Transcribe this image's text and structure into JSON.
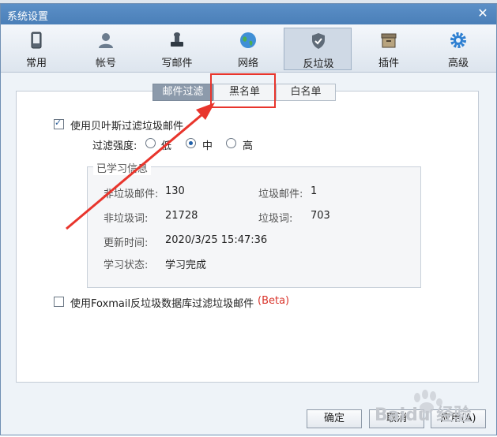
{
  "window": {
    "title": "系统设置",
    "close_glyph": "✕"
  },
  "toolbar": {
    "items": [
      {
        "label": "常用",
        "icon": "phone-icon"
      },
      {
        "label": "帐号",
        "icon": "user-icon"
      },
      {
        "label": "写邮件",
        "icon": "ink-stamp-icon"
      },
      {
        "label": "网络",
        "icon": "globe-icon"
      },
      {
        "label": "反垃圾",
        "icon": "shield-icon",
        "active": true
      },
      {
        "label": "插件",
        "icon": "box-icon"
      },
      {
        "label": "高级",
        "icon": "gear-icon"
      }
    ]
  },
  "tabs": {
    "items": [
      {
        "label": "邮件过滤",
        "active": true
      },
      {
        "label": "黑名单",
        "active": false
      },
      {
        "label": "白名单",
        "active": false
      }
    ]
  },
  "bayes": {
    "label": "使用贝叶斯过滤垃圾邮件",
    "checked": true,
    "strength_label": "过滤强度:",
    "options": [
      {
        "label": "低",
        "checked": false
      },
      {
        "label": "中",
        "checked": true
      },
      {
        "label": "高",
        "checked": false
      }
    ]
  },
  "learned": {
    "legend": "已学习信息",
    "nonspam_mail_label": "非垃圾邮件:",
    "nonspam_mail_value": "130",
    "spam_mail_label": "垃圾邮件:",
    "spam_mail_value": "1",
    "nonspam_words_label": "非垃圾词:",
    "nonspam_words_value": "21728",
    "spam_words_label": "垃圾词:",
    "spam_words_value": "703",
    "update_time_label": "更新时间:",
    "update_time_value": "2020/3/25 15:47:36",
    "status_label": "学习状态:",
    "status_value": "学习完成"
  },
  "foxmail_db": {
    "label": "使用Foxmail反垃圾数据库过滤垃圾邮件",
    "beta": "(Beta)",
    "checked": false
  },
  "buttons": {
    "ok": "确定",
    "cancel": "取消",
    "apply": "应用(A)"
  },
  "watermark": {
    "text": "Baidu 经验"
  },
  "colors": {
    "accent": "#4a7fb8",
    "annotation_red": "#e8352c",
    "beta_red": "#d9342b"
  }
}
